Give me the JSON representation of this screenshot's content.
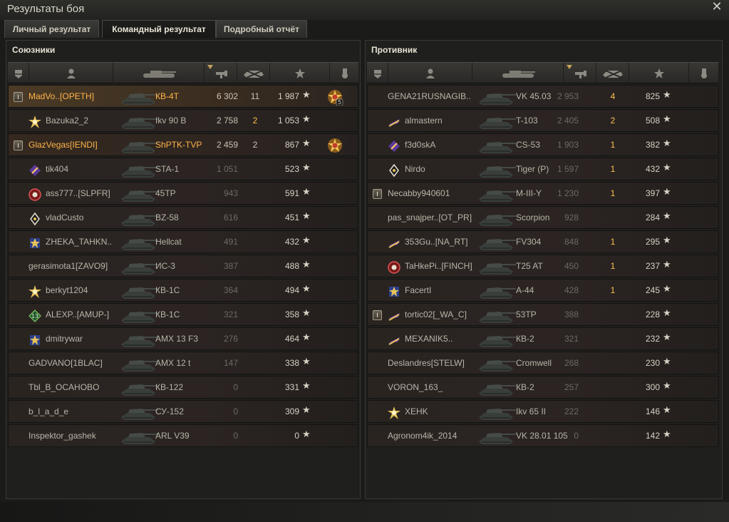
{
  "window": {
    "title": "Результаты боя",
    "close_icon": "close-icon"
  },
  "tabs": [
    {
      "label": "Личный результат",
      "active": false
    },
    {
      "label": "Командный результат",
      "active": true
    },
    {
      "label": "Подробный отчёт",
      "active": false
    }
  ],
  "allies": {
    "title": "Союзники",
    "rows": [
      {
        "name": "MadVo..[OPETH]",
        "tank": "КВ-4Т",
        "damage": "6 302",
        "kills": "11",
        "xp": "1 987",
        "platoon": true,
        "highlight": "me",
        "medal": true,
        "medal_count": "5"
      },
      {
        "name": "Bazuka2_2",
        "mark": "gold",
        "tank": "Ikv 90 B",
        "damage": "2 758",
        "kills": "2",
        "xp": "1 053"
      },
      {
        "name": "GlazVegas[IENDI]",
        "tank": "ShPTK-TVP",
        "damage": "2 459",
        "kills": "2",
        "xp": "867",
        "platoon": true,
        "highlight": "plat",
        "medal": true
      },
      {
        "name": "tik404",
        "mark": "purple",
        "tank": "STA-1",
        "damage": "1 051",
        "kills": "",
        "xp": "523",
        "dim": true
      },
      {
        "name": "ass777..[SLPFR]",
        "mark": "red-ring",
        "tank": "45TP",
        "damage": "943",
        "kills": "",
        "xp": "591",
        "dim": true
      },
      {
        "name": "vladCusto",
        "mark": "white-diamond",
        "tank": "BZ-58",
        "damage": "616",
        "kills": "",
        "xp": "451",
        "dim": true
      },
      {
        "name": "ZHEKA_TAHKN..",
        "mark": "blue-gold",
        "tank": "Hellcat",
        "damage": "491",
        "kills": "",
        "xp": "432",
        "dim": true
      },
      {
        "name": "gerasimota1[ZAVO9]",
        "tank": "ИС-3",
        "damage": "387",
        "kills": "",
        "xp": "488",
        "dim": true
      },
      {
        "name": "berkyt1204",
        "mark": "gold",
        "tank": "КВ-1С",
        "damage": "364",
        "kills": "",
        "xp": "494",
        "dim": true
      },
      {
        "name": "ALEXP..[AMUP-]",
        "mark": "green-13",
        "tank": "КВ-1С",
        "damage": "321",
        "kills": "",
        "xp": "358",
        "dim": true
      },
      {
        "name": "dmitrywar",
        "mark": "blue-gold",
        "tank": "AMX 13 F3",
        "damage": "276",
        "kills": "",
        "xp": "464",
        "dim": true
      },
      {
        "name": "GADVANO[1BLAC]",
        "tank": "AMX 12 t",
        "damage": "147",
        "kills": "",
        "xp": "338",
        "dim": true
      },
      {
        "name": "Tbl_B_OCAHOBO",
        "tank": "КВ-122",
        "damage": "0",
        "kills": "",
        "xp": "331",
        "dim": true
      },
      {
        "name": "b_l_a_d_e",
        "tank": "СУ-152",
        "damage": "0",
        "kills": "",
        "xp": "309",
        "dim": true
      },
      {
        "name": "Inspektor_gashek",
        "tank": "ARL V39",
        "damage": "0",
        "kills": "",
        "xp": "0",
        "dim": true
      }
    ]
  },
  "enemies": {
    "title": "Противник",
    "rows": [
      {
        "name": "GENA21RUSNAGIB..",
        "tank": "VK 45.03",
        "damage": "2 953",
        "kills": "4",
        "xp": "825",
        "dim": true
      },
      {
        "name": "almastern",
        "mark": "purple-arrow",
        "tank": "T-103",
        "damage": "2 405",
        "kills": "2",
        "xp": "508",
        "dim": true
      },
      {
        "name": "f3d0skA",
        "mark": "purple",
        "tank": "CS-53",
        "damage": "1 903",
        "kills": "1",
        "xp": "382",
        "dim": true
      },
      {
        "name": "Nirdo",
        "mark": "white-diamond",
        "tank": "Tiger (P)",
        "damage": "1 597",
        "kills": "1",
        "xp": "432",
        "dim": true
      },
      {
        "name": "Necabby940601",
        "platoon": true,
        "tank": "M-III-Y",
        "damage": "1 230",
        "kills": "1",
        "xp": "397",
        "dim": true
      },
      {
        "name": "pas_snajper..[OT_PR]",
        "tank": "Scorpion",
        "damage": "928",
        "kills": "",
        "xp": "284",
        "dim": true
      },
      {
        "name": "353Gu..[NA_RT]",
        "mark": "purple-arrow",
        "tank": "FV304",
        "damage": "848",
        "kills": "1",
        "xp": "295",
        "dim": true
      },
      {
        "name": "TaHkePi..[FINCH]",
        "mark": "red-ring",
        "tank": "T25 AT",
        "damage": "450",
        "kills": "1",
        "xp": "237",
        "dim": true
      },
      {
        "name": "FacertI",
        "mark": "blue-gold",
        "tank": "A-44",
        "damage": "428",
        "kills": "1",
        "xp": "245",
        "dim": true
      },
      {
        "name": "tortic02[_WA_C]",
        "platoon": true,
        "mark": "purple-arrow",
        "tank": "53TP",
        "damage": "388",
        "kills": "",
        "xp": "228",
        "dim": true
      },
      {
        "name": "MEXANIK5..",
        "mark": "purple-arrow",
        "tank": "КВ-2",
        "damage": "321",
        "kills": "",
        "xp": "232",
        "dim": true
      },
      {
        "name": "Deslandres[STELW]",
        "tank": "Cromwell",
        "damage": "268",
        "kills": "",
        "xp": "230",
        "dim": true
      },
      {
        "name": "VORON_163_",
        "tank": "КВ-2",
        "damage": "257",
        "kills": "",
        "xp": "300",
        "dim": true
      },
      {
        "name": "XEHK",
        "mark": "gold",
        "tank": "Ikv 65 II",
        "damage": "222",
        "kills": "",
        "xp": "146",
        "dim": true
      },
      {
        "name": "Agronom4ik_2014",
        "tank": "VK 28.01 105",
        "damage": "0",
        "kills": "",
        "xp": "142",
        "dim": true
      }
    ]
  },
  "colors": {
    "highlight_name": "#ffb34a",
    "kills": "#ffc04f"
  }
}
